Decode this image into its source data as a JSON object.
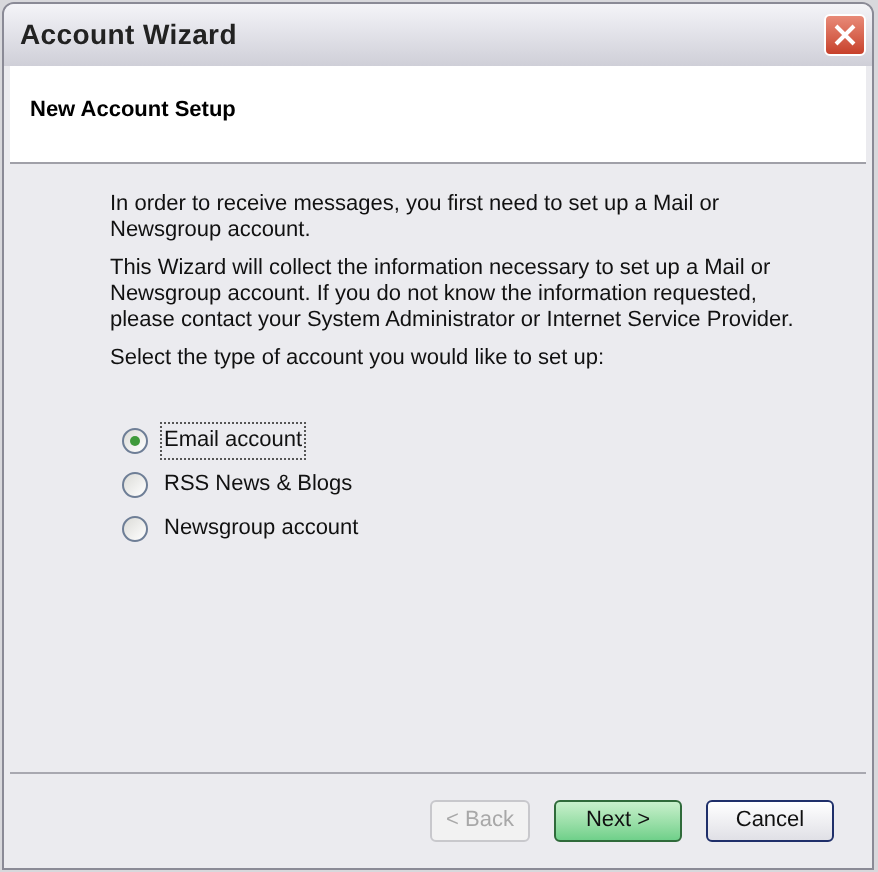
{
  "window": {
    "title": "Account Wizard"
  },
  "header": {
    "title": "New Account Setup"
  },
  "paragraphs": [
    "In order to receive messages, you first need to set up a Mail or Newsgroup account.",
    "This Wizard will collect the information necessary to set up a Mail or Newsgroup account. If you do not know the information requested, please contact your System Administrator or Internet Service Provider.",
    "Select the type of account you would like to set up:"
  ],
  "account_types": [
    {
      "label": "Email account",
      "selected": true
    },
    {
      "label": "RSS News & Blogs",
      "selected": false
    },
    {
      "label": "Newsgroup account",
      "selected": false
    }
  ],
  "buttons": [
    {
      "label": "< Back",
      "disabled": true,
      "default": false
    },
    {
      "label": "Next >",
      "disabled": false,
      "default": true
    },
    {
      "label": "Cancel",
      "disabled": false,
      "default": false
    }
  ]
}
